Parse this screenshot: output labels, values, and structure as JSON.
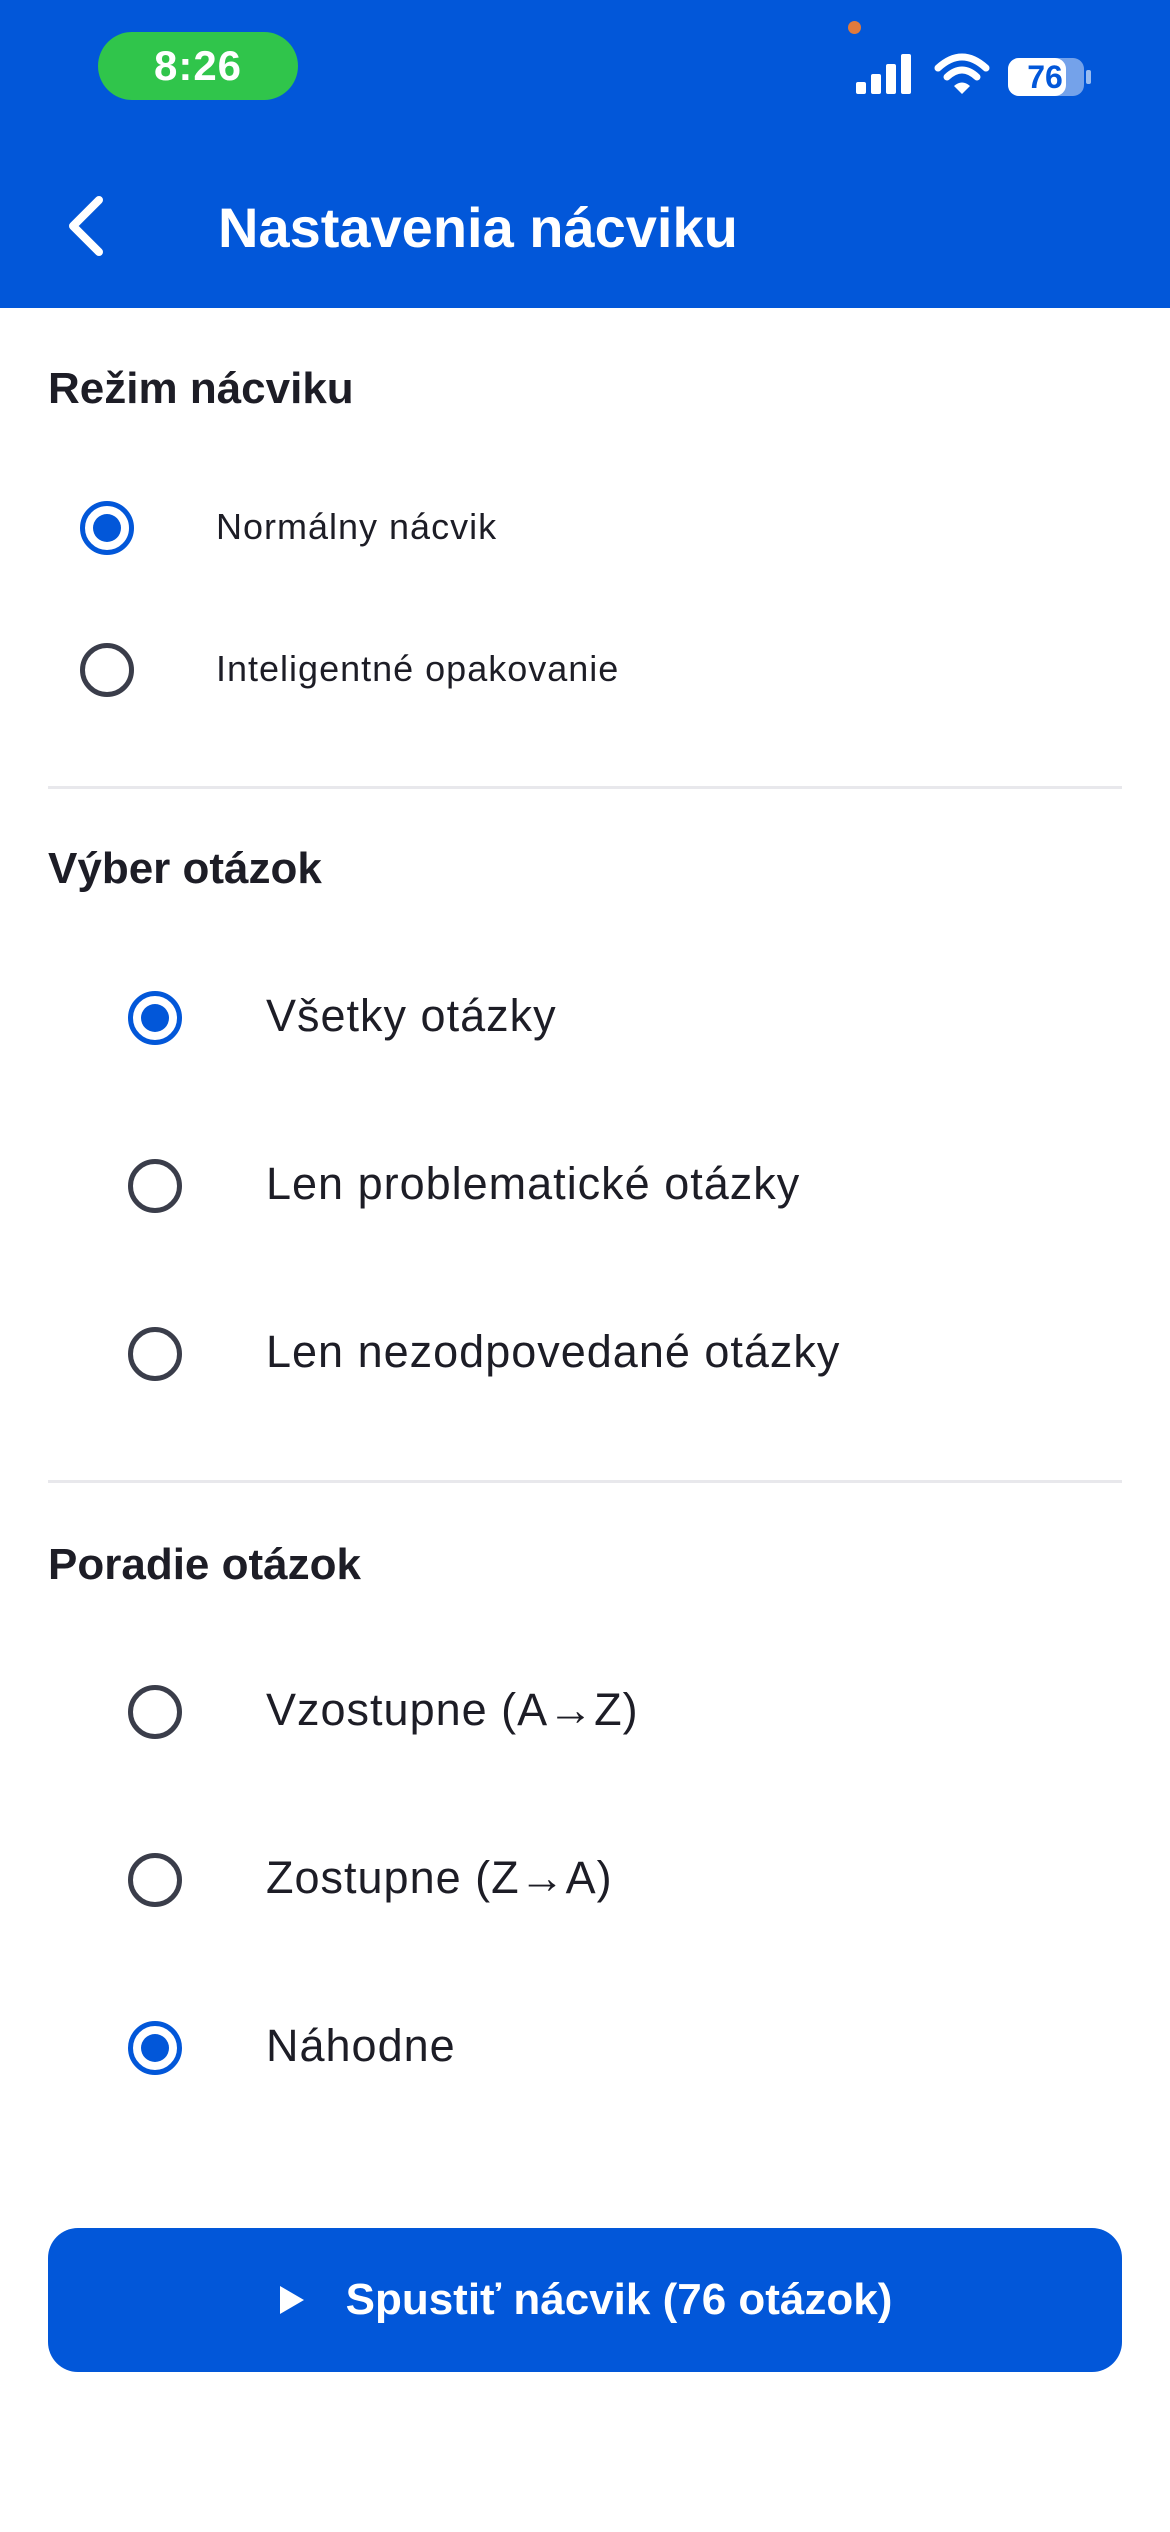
{
  "status_bar": {
    "time": "8:26",
    "battery": "76",
    "icons": [
      "signal-icon",
      "wifi-icon",
      "battery-icon"
    ]
  },
  "header": {
    "back_icon": "chevron-left-icon",
    "title": "Nastavenia nácviku",
    "background_color": "#0257d9"
  },
  "sections": {
    "mode": {
      "title": "Režim nácviku",
      "options": [
        {
          "label": "Normálny nácvik",
          "selected": true
        },
        {
          "label": "Inteligentné opakovanie",
          "selected": false
        }
      ]
    },
    "selection": {
      "title": "Výber otázok",
      "options": [
        {
          "label": "Všetky otázky",
          "selected": true
        },
        {
          "label": "Len problematické otázky",
          "selected": false
        },
        {
          "label": "Len nezodpovedané otázky",
          "selected": false
        }
      ]
    },
    "order": {
      "title": "Poradie otázok",
      "options": [
        {
          "label": "Vzostupne (A→Z)",
          "selected": false
        },
        {
          "label": "Zostupne (Z→A)",
          "selected": false
        },
        {
          "label": "Náhodne",
          "selected": true
        }
      ]
    }
  },
  "start_button": {
    "icon": "play-icon",
    "label": "Spustiť nácvik (76 otázok)"
  },
  "accent_color": "#0257d9"
}
